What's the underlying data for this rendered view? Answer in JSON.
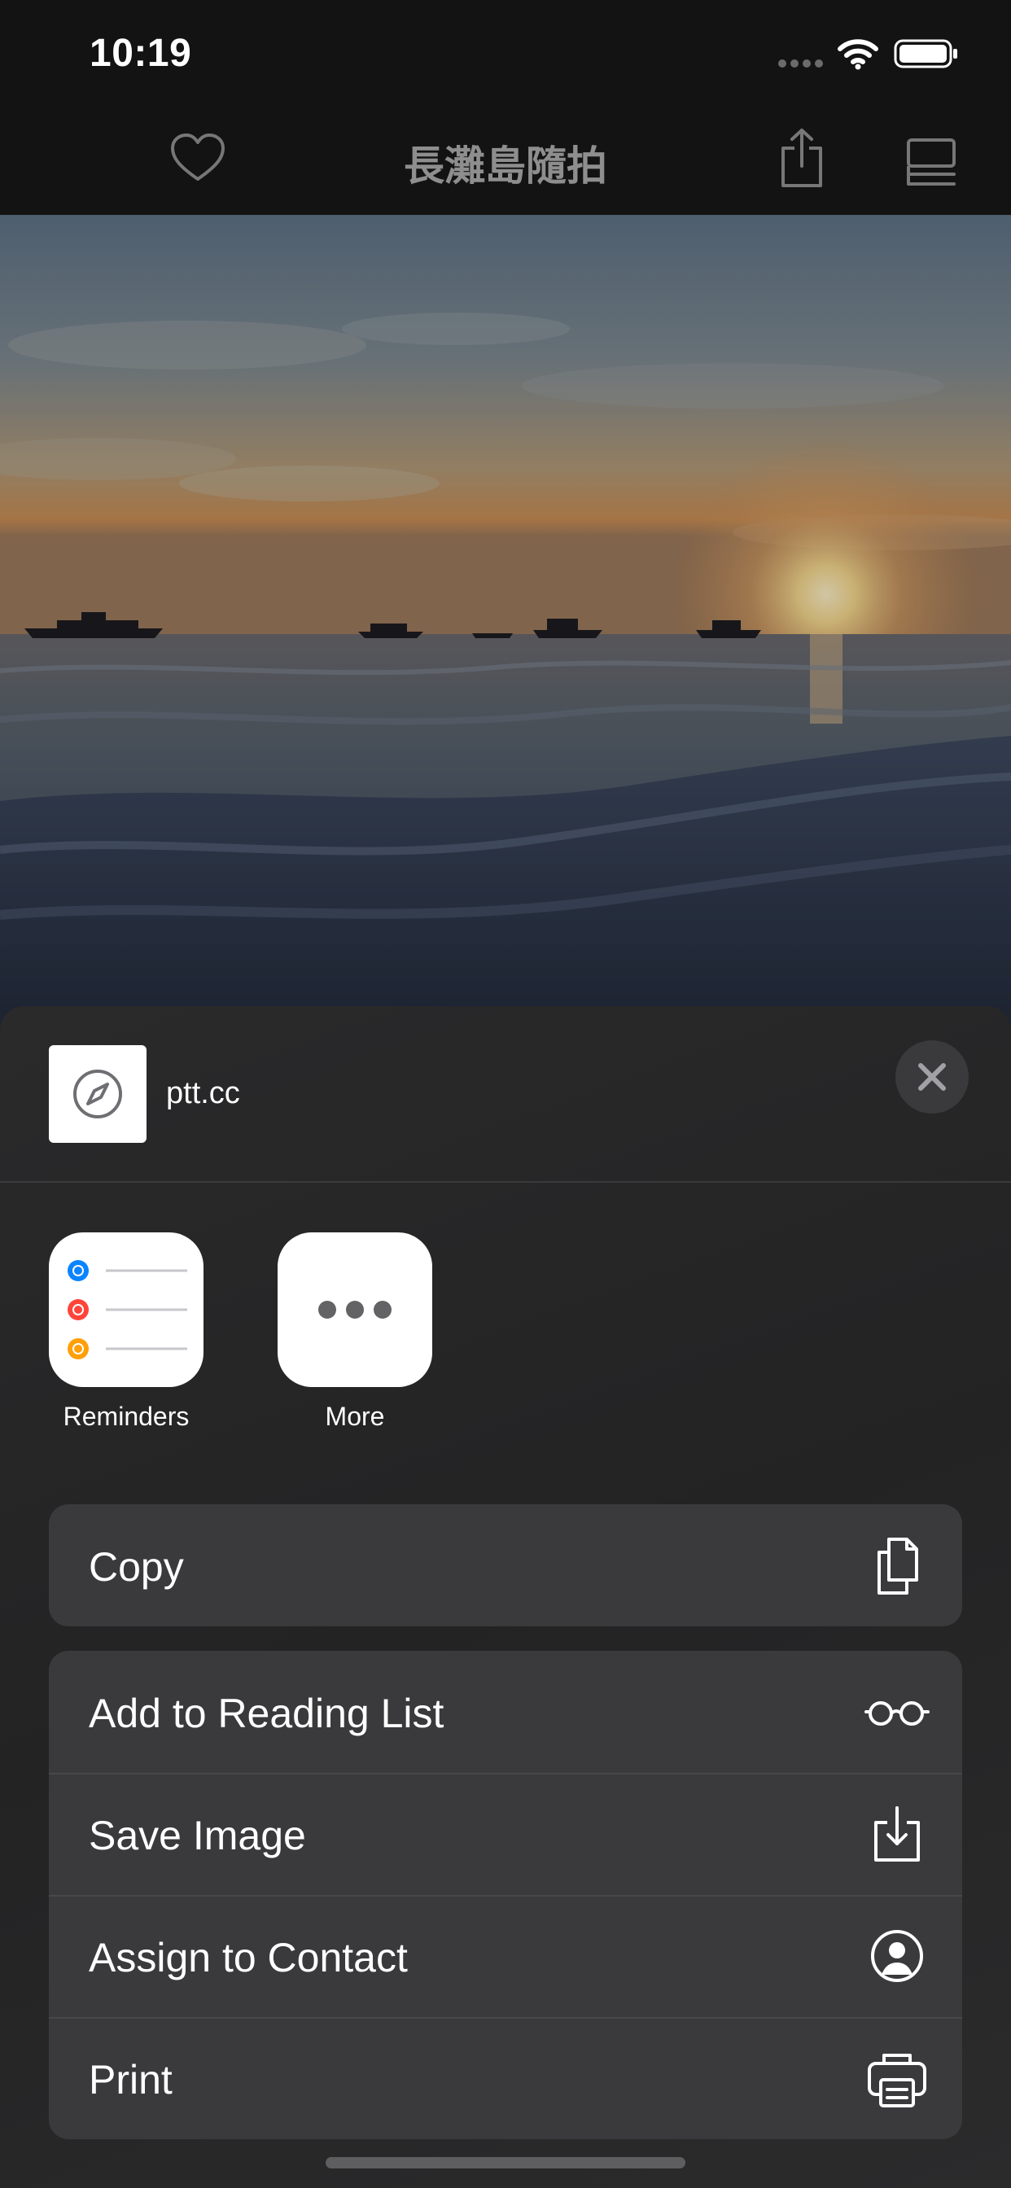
{
  "status_bar": {
    "time": "10:19",
    "signal_icon": "signal-dots-icon",
    "wifi_icon": "wifi-icon",
    "battery_icon": "battery-full-icon"
  },
  "nav": {
    "title": "長灘島隨拍",
    "left_icon": "heart-icon",
    "share_icon": "share-icon",
    "tabs_icon": "tabs-icon"
  },
  "photo": {
    "subject": "sunset-over-sea"
  },
  "share_sheet": {
    "site_name": "ptt.cc",
    "site_icon": "compass-icon",
    "close_icon": "close-icon",
    "apps": [
      {
        "label": "Reminders",
        "icon": "reminders-icon"
      },
      {
        "label": "More",
        "icon": "more-icon"
      }
    ],
    "copy_action": {
      "label": "Copy",
      "icon": "copy-icon"
    },
    "actions": [
      {
        "label": "Add to Reading List",
        "icon": "glasses-icon"
      },
      {
        "label": "Save Image",
        "icon": "save-image-icon"
      },
      {
        "label": "Assign to Contact",
        "icon": "contact-icon"
      },
      {
        "label": "Print",
        "icon": "printer-icon"
      }
    ]
  },
  "colors": {
    "sheet_background": "#262627",
    "row_background": "#3a3a3c",
    "reminder_blue": "#0a84ff",
    "reminder_red": "#ff453a",
    "reminder_orange": "#ff9f0a"
  }
}
